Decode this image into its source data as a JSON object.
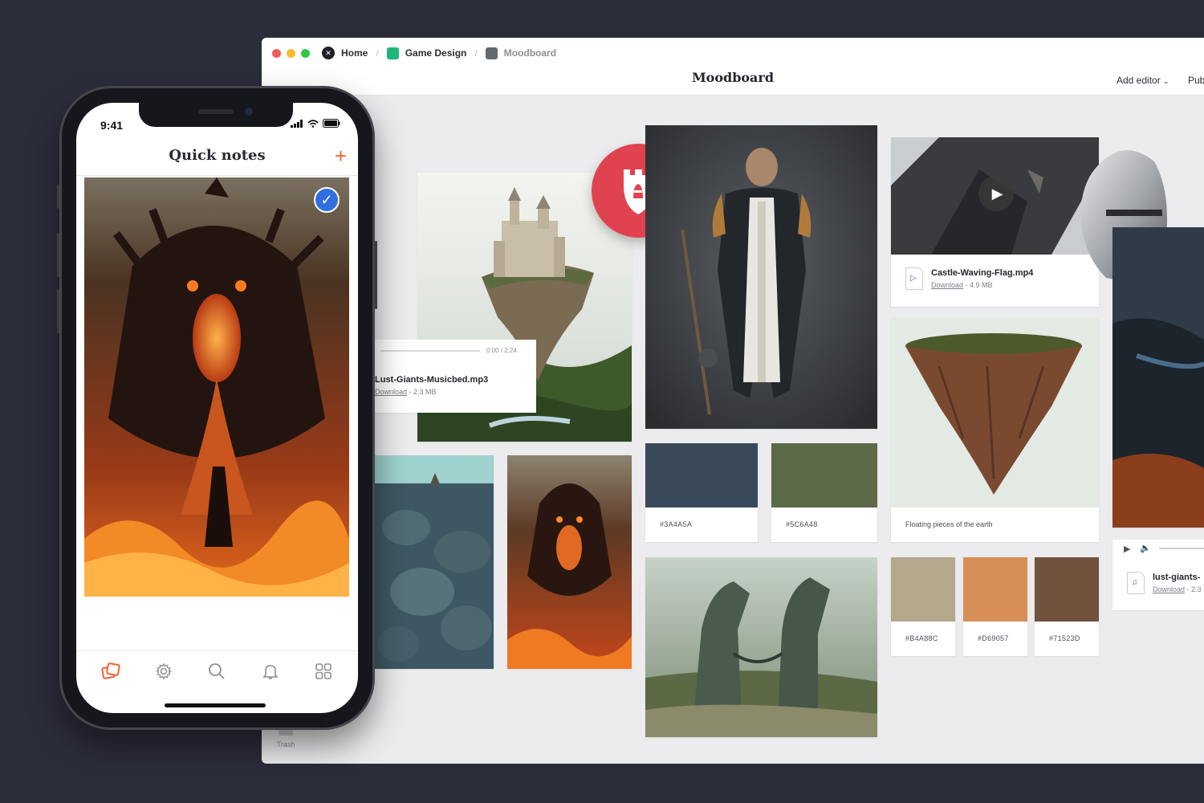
{
  "window": {
    "breadcrumbs": [
      "Home",
      "Game Design",
      "Moodboard"
    ],
    "title": "Moodboard",
    "add_editor": "Add editor",
    "publish": "Pub",
    "sidebar_trash": "Trash"
  },
  "cards": {
    "audio_file": {
      "name": "Lust-Giants-Musicbed.mp3",
      "download": "Download",
      "size": "- 2.3 MB",
      "time": "0:00 / 2:24"
    },
    "video_file": {
      "name": "Castle-Waving-Flag.mp4",
      "download": "Download",
      "size": "- 4.9 MB"
    },
    "floating_caption": "Floating pieces of the earth",
    "audio_file_2": {
      "name": "lust-giants-",
      "download": "Download",
      "size": "- 2.3"
    }
  },
  "swatches": [
    {
      "hex": "#3A4A5A",
      "color": "#3a4a5a"
    },
    {
      "hex": "#5C6A48",
      "color": "#5c6a48"
    },
    {
      "hex": "#B4A88C",
      "color": "#b4a88c"
    },
    {
      "hex": "#D69057",
      "color": "#d69057"
    },
    {
      "hex": "#71523D",
      "color": "#71523d"
    }
  ],
  "phone": {
    "time": "9:41",
    "title": "Quick notes",
    "tabs": [
      "notes-icon",
      "gear-icon",
      "search-icon",
      "bell-icon",
      "grid-icon"
    ]
  },
  "colors": {
    "accent": "#f06433",
    "check": "#2f6fe0",
    "badge": "#e1424f"
  }
}
